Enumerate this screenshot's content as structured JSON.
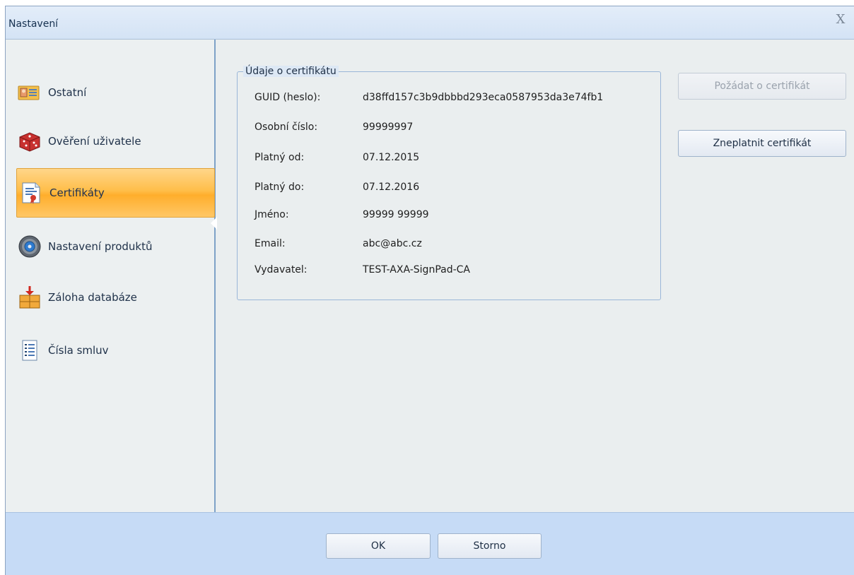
{
  "window": {
    "title": "Nastavení",
    "close_glyph": "X"
  },
  "sidebar": {
    "items": [
      {
        "label": "Ostatní",
        "icon": "contact-card-icon",
        "active": false
      },
      {
        "label": "Ověření uživatele",
        "icon": "dice-icon",
        "active": false
      },
      {
        "label": "Certifikáty",
        "icon": "certificate-icon",
        "active": true
      },
      {
        "label": "Nastavení produktů",
        "icon": "gear-disc-icon",
        "active": false
      },
      {
        "label": "Záloha databáze",
        "icon": "database-backup-icon",
        "active": false
      },
      {
        "label": "Čísla smluv",
        "icon": "numbered-list-icon",
        "active": false
      }
    ]
  },
  "certificate": {
    "group_title": "Údaje o certifikátu",
    "fields": [
      {
        "label": "GUID (heslo):",
        "value": "d38ffd157c3b9dbbbd293eca0587953da3e74fb1"
      },
      {
        "label": "Osobní číslo:",
        "value": "99999997"
      },
      {
        "label": "Platný od:",
        "value": "07.12.2015"
      },
      {
        "label": "Platný do:",
        "value": "07.12.2016"
      },
      {
        "label": "Jméno:",
        "value": "99999 99999"
      },
      {
        "label": "Email:",
        "value": "abc@abc.cz"
      },
      {
        "label": "Vydavatel:",
        "value": "TEST-AXA-SignPad-CA"
      }
    ]
  },
  "actions": {
    "request_label": "Požádat o certifikát",
    "request_disabled": true,
    "revoke_label": "Zneplatnit certifikát"
  },
  "footer": {
    "ok_label": "OK",
    "cancel_label": "Storno"
  },
  "colors": {
    "active_item": "#ffb93f",
    "title_bar": "#dbe7f6",
    "footer": "#c6dbf6",
    "group_border": "#9ab6d8"
  }
}
